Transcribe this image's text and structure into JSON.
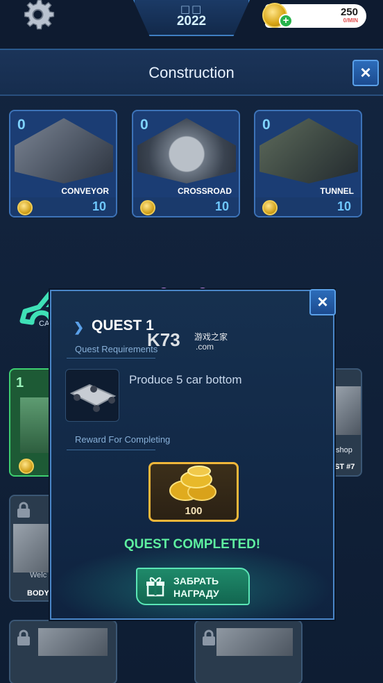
{
  "top": {
    "year_boxes": "□□",
    "year": "2022",
    "income_value": "250",
    "income_unit": "0/MIN"
  },
  "panel": {
    "title": "Construction"
  },
  "cards": [
    {
      "count": "0",
      "label": "CONVEYOR",
      "price": "10"
    },
    {
      "count": "0",
      "label": "CROSSROAD",
      "price": "10"
    },
    {
      "count": "0",
      "label": "TUNNEL",
      "price": "10"
    }
  ],
  "categories": {
    "car_partial": "CA"
  },
  "side_cards": {
    "left_count": "1",
    "right_label_partial": "shop",
    "right_sub_partial": "ST #7",
    "lower_left_label_partial": "Welc",
    "lower_left_sub_partial": "BODY"
  },
  "quest": {
    "title": "QUEST 1",
    "requirements_label": "Quest Requirements",
    "requirement_text": "Produce 5 car bottom",
    "reward_label": "Reward For Completing",
    "reward_value": "100",
    "status": "QUEST COMPLETED!",
    "claim_line1": "ЗАБРАТЬ",
    "claim_line2": "НАГРАДУ"
  },
  "watermark": {
    "logo": "K73",
    "cn": "游戏之家",
    "domain": ".com"
  },
  "colors": {
    "accent": "#4a86c8",
    "status_green": "#5ef0a0",
    "claim_button": "#1f8a6a",
    "coin_gold": "#d7a413"
  },
  "icons": {
    "settings": "gear-icon",
    "currency": "gold-coin-icon",
    "add": "plus-icon",
    "close": "close-icon",
    "gift": "gift-icon",
    "lock": "lock-icon"
  }
}
